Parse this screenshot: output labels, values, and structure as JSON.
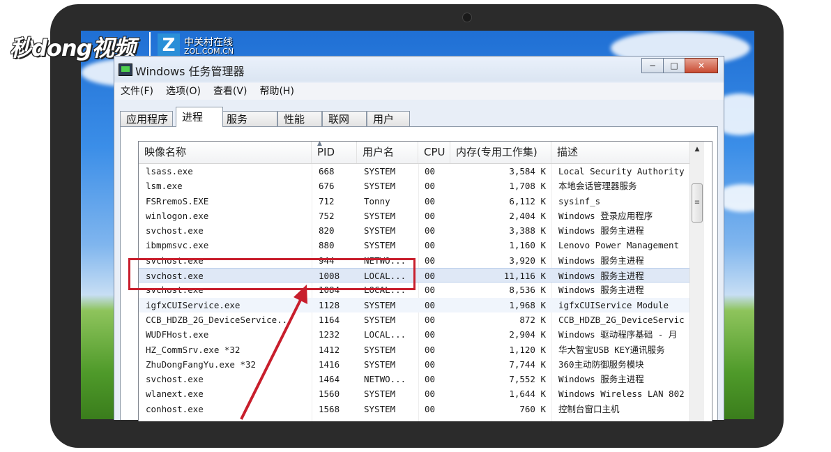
{
  "branding": {
    "logo_text": "秒dong视频",
    "zol_mark": "Z",
    "zol_cn": "中关村在线",
    "zol_en": "ZOL.COM.CN"
  },
  "window": {
    "title": "Windows 任务管理器",
    "buttons": {
      "minimize": "−",
      "maximize": "□",
      "close": "✕"
    }
  },
  "menu": [
    "文件(F)",
    "选项(O)",
    "查看(V)",
    "帮助(H)"
  ],
  "tabs": [
    "应用程序",
    "进程",
    "服务",
    "性能",
    "联网",
    "用户"
  ],
  "active_tab": "进程",
  "columns": {
    "name": "映像名称",
    "pid": "PID",
    "user": "用户名",
    "cpu": "CPU",
    "mem": "内存(专用工作集)",
    "desc": "描述"
  },
  "processes": [
    {
      "name": "lsass.exe",
      "pid": "668",
      "user": "SYSTEM",
      "cpu": "00",
      "mem": "3,584 K",
      "desc": "Local Security Authority"
    },
    {
      "name": "lsm.exe",
      "pid": "676",
      "user": "SYSTEM",
      "cpu": "00",
      "mem": "1,708 K",
      "desc": "本地会话管理器服务"
    },
    {
      "name": "FSRremoS.EXE",
      "pid": "712",
      "user": "Tonny",
      "cpu": "00",
      "mem": "6,112 K",
      "desc": "sysinf_s"
    },
    {
      "name": "winlogon.exe",
      "pid": "752",
      "user": "SYSTEM",
      "cpu": "00",
      "mem": "2,404 K",
      "desc": "Windows 登录应用程序"
    },
    {
      "name": "svchost.exe",
      "pid": "820",
      "user": "SYSTEM",
      "cpu": "00",
      "mem": "3,388 K",
      "desc": "Windows 服务主进程"
    },
    {
      "name": "ibmpmsvc.exe",
      "pid": "880",
      "user": "SYSTEM",
      "cpu": "00",
      "mem": "1,160 K",
      "desc": "Lenovo Power Management"
    },
    {
      "name": "svchost.exe",
      "pid": "944",
      "user": "NETWO...",
      "cpu": "00",
      "mem": "3,920 K",
      "desc": "Windows 服务主进程"
    },
    {
      "name": "svchost.exe",
      "pid": "1008",
      "user": "LOCAL...",
      "cpu": "00",
      "mem": "11,116 K",
      "desc": "Windows 服务主进程"
    },
    {
      "name": "svchost.exe",
      "pid": "1084",
      "user": "LOCAL...",
      "cpu": "00",
      "mem": "8,536 K",
      "desc": "Windows 服务主进程"
    },
    {
      "name": "igfxCUIService.exe",
      "pid": "1128",
      "user": "SYSTEM",
      "cpu": "00",
      "mem": "1,968 K",
      "desc": "igfxCUIService Module"
    },
    {
      "name": "CCB_HDZB_2G_DeviceService...",
      "pid": "1164",
      "user": "SYSTEM",
      "cpu": "00",
      "mem": "872 K",
      "desc": "CCB_HDZB_2G_DeviceServic"
    },
    {
      "name": "WUDFHost.exe",
      "pid": "1232",
      "user": "LOCAL...",
      "cpu": "00",
      "mem": "2,904 K",
      "desc": "Windows 驱动程序基础 - 月"
    },
    {
      "name": "HZ_CommSrv.exe *32",
      "pid": "1412",
      "user": "SYSTEM",
      "cpu": "00",
      "mem": "1,120 K",
      "desc": "华大智宝USB KEY通讯服务"
    },
    {
      "name": "ZhuDongFangYu.exe *32",
      "pid": "1416",
      "user": "SYSTEM",
      "cpu": "00",
      "mem": "7,744 K",
      "desc": "360主动防御服务模块"
    },
    {
      "name": "svchost.exe",
      "pid": "1464",
      "user": "NETWO...",
      "cpu": "00",
      "mem": "7,552 K",
      "desc": "Windows 服务主进程"
    },
    {
      "name": "wlanext.exe",
      "pid": "1560",
      "user": "SYSTEM",
      "cpu": "00",
      "mem": "1,644 K",
      "desc": "Windows Wireless LAN 802"
    },
    {
      "name": "conhost.exe",
      "pid": "1568",
      "user": "SYSTEM",
      "cpu": "00",
      "mem": "760 K",
      "desc": "控制台窗口主机"
    }
  ],
  "selected_pid": "1008",
  "scrollbar": {
    "up_arrow": "▲",
    "thumb_grip": "≡"
  },
  "colors": {
    "highlight": "#c81e2c",
    "selection": "#dfe8f6"
  }
}
